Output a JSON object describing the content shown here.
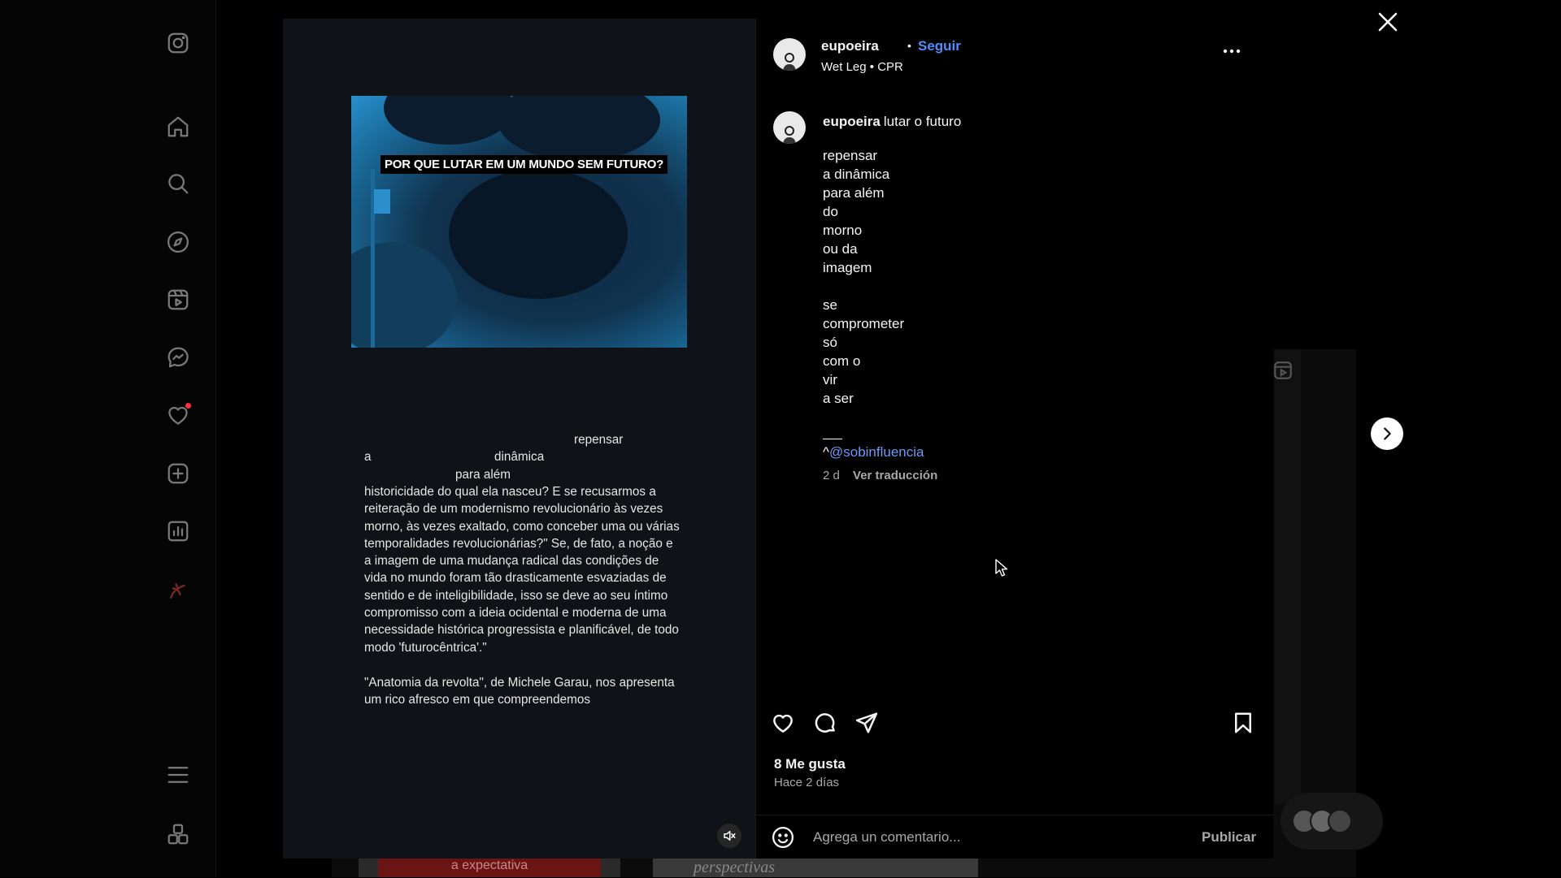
{
  "sidebar": {
    "icons": [
      "instagram-logo-icon",
      "home-icon",
      "search-icon",
      "explore-icon",
      "reels-icon",
      "messenger-icon",
      "heart-notification-icon",
      "create-plus-icon",
      "dashboard-icon",
      "profile-avatar-icon",
      "menu-icon",
      "more-apps-icon"
    ]
  },
  "background": {
    "thumb1_text": "a expectativa",
    "thumb2_text": "perspectivas"
  },
  "media": {
    "image_title": "POR QUE LUTAR EM UM MUNDO SEM FUTURO?",
    "scatter_words": [
      "repensar",
      "a",
      "dinâmica",
      "para além"
    ],
    "paragraph1": "historicidade do qual ela nasceu? E se recusarmos a reiteração de um modernismo revolucionário às vezes morno, às vezes exaltado, como conceber uma ou várias temporalidades revolucionárias?\" Se, de fato, a noção e a imagem de uma mudança radical das condições de vida no mundo foram tão drasticamente esvaziadas de sentido e de inteligibilidade, isso se deve ao seu íntimo compromisso com a ideia ocidental e moderna de uma necessidade histórica progressista e planificável, de todo modo 'futurocêntrica'.\"",
    "paragraph2": "\"Anatomia da revolta\", de Michele Garau, nos apresenta um rico afresco em que compreendemos"
  },
  "post": {
    "username": "eupoeira",
    "dot": "•",
    "follow_label": "Seguir",
    "audio_artist": "Wet Leg",
    "audio_sep": "•",
    "audio_track": "CPR",
    "caption_user": "eupoeira",
    "caption_first": "lutar o futuro",
    "caption_block1": [
      "repensar",
      "a dinâmica",
      "para além",
      "do",
      "morno",
      "ou da",
      "imagem"
    ],
    "caption_block2": [
      "se",
      "comprometer",
      "só",
      "com o",
      "vir",
      "a ser"
    ],
    "caption_mention_prefix": "^",
    "caption_mention": "@sobinfluencia",
    "caption_time": "2 d",
    "translate_label": "Ver traducción",
    "likes": "8 Me gusta",
    "posted_ago": "Hace 2 días",
    "comment_placeholder": "Agrega un comentario...",
    "publish_label": "Publicar"
  },
  "colors": {
    "accent": "#4f8dfb",
    "mention": "#6b9af5",
    "notification_dot": "#ff3040",
    "secondary_text": "#a8a8a8"
  }
}
